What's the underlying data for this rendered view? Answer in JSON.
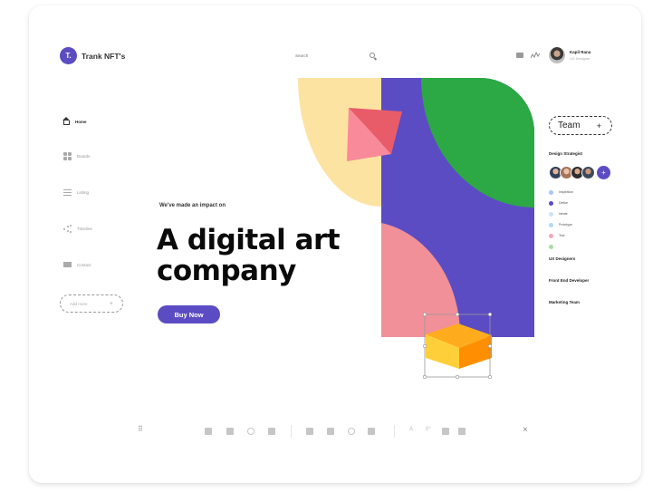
{
  "app": {
    "logo_letter": "T.",
    "logo_name": "Trank NFT's"
  },
  "header": {
    "search_placeholder": "Search",
    "icons": [
      "mail-icon",
      "activity-icon"
    ],
    "user": {
      "name": "Kapil Rana",
      "role": "UX Designer"
    }
  },
  "sidebar": {
    "items": [
      {
        "label": "Home",
        "icon": "home-icon",
        "active": true
      },
      {
        "label": "Boards",
        "icon": "boards-icon",
        "active": false
      },
      {
        "label": "Listing",
        "icon": "listing-icon",
        "active": false
      },
      {
        "label": "Timeline",
        "icon": "timeline-icon",
        "active": false
      },
      {
        "label": "Contact",
        "icon": "contact-icon",
        "active": false
      }
    ],
    "add_button": {
      "label": "Add more",
      "icon": "+"
    }
  },
  "hero": {
    "tagline": "We've made an impact on",
    "headline_line1": "A digital art",
    "headline_line2": "company",
    "cta": "Buy Now"
  },
  "colors": {
    "brand": "#5b4cc4",
    "yellow": "#fde3a2",
    "green": "#2ca844",
    "pink": "#f19098",
    "red": "#e85c6a",
    "orange": "#ff9e1b"
  },
  "right_panel": {
    "team_button": {
      "label": "Team",
      "icon": "+"
    },
    "design_title": "Design Strategist",
    "avatar_add": "+",
    "legend": [
      {
        "label": "Inspiration",
        "color": "#a9c8f5"
      },
      {
        "label": "Define",
        "color": "#5b4cc4"
      },
      {
        "label": "Ideate",
        "color": "#c9e4fb"
      },
      {
        "label": "Prototype",
        "color": "#b5daf7"
      },
      {
        "label": "Test",
        "color": "#f2a8b8"
      },
      {
        "label": "",
        "color": "#a9dca2"
      }
    ],
    "teams": [
      "UX Designers",
      "Front End Developer",
      "Marketing Team"
    ]
  },
  "toolbar": {
    "close": "×",
    "text_tools": [
      "A",
      "0°"
    ]
  }
}
